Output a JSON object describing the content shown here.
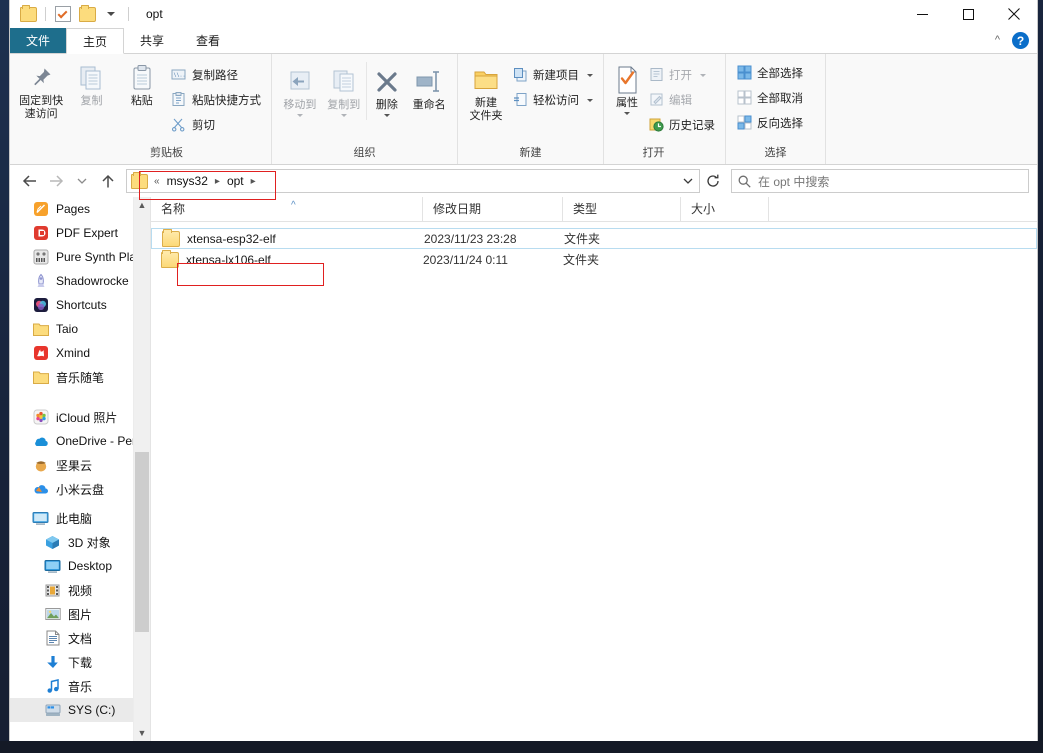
{
  "window": {
    "title": "opt",
    "controls": {
      "minimize": "minimize-icon",
      "maximize": "maximize-icon",
      "close": "close-icon"
    },
    "quick_access": [
      "folder-icon",
      "properties-checkbox-icon",
      "new-folder-icon",
      "customize-caret-icon"
    ]
  },
  "tabs": [
    {
      "label": "文件",
      "type": "file"
    },
    {
      "label": "主页",
      "type": "active"
    },
    {
      "label": "共享",
      "type": "normal"
    },
    {
      "label": "查看",
      "type": "normal"
    }
  ],
  "tabstrip_right": {
    "collapse_icon": "chevron-up-icon",
    "help_label": "?"
  },
  "ribbon": {
    "groups": [
      {
        "name": "clipboard",
        "label": "剪贴板",
        "big_buttons": [
          {
            "label": "固定到快\n速访问",
            "label_l1": "固定到快",
            "label_l2": "速访问",
            "icon": "pin-icon",
            "dim": false
          },
          {
            "label": "复制",
            "icon": "copy-icon",
            "dim": true
          },
          {
            "label": "粘贴",
            "icon": "paste-icon",
            "dim": false
          }
        ],
        "small_buttons": [
          {
            "label": "复制路径",
            "icon": "copy-path-icon",
            "dim": false
          },
          {
            "label": "粘贴快捷方式",
            "icon": "paste-shortcut-icon",
            "dim": false
          },
          {
            "label": "剪切",
            "icon": "scissors-icon",
            "dim": false
          }
        ]
      },
      {
        "name": "organize",
        "label": "组织",
        "big_buttons": [
          {
            "label": "移动到",
            "icon": "move-to-icon",
            "dim": true,
            "caret": true
          },
          {
            "label": "复制到",
            "icon": "copy-to-icon",
            "dim": true,
            "caret": true
          },
          {
            "label": "删除",
            "icon": "delete-x-icon",
            "dim": false,
            "caret": true
          },
          {
            "label": "重命名",
            "icon": "rename-icon",
            "dim": false
          }
        ]
      },
      {
        "name": "new",
        "label": "新建",
        "big_buttons": [
          {
            "label_l1": "新建",
            "label_l2": "文件夹",
            "icon": "new-folder-icon",
            "dim": false
          }
        ],
        "small_buttons": [
          {
            "label": "新建项目",
            "icon": "new-item-icon",
            "dim": false,
            "caret": true
          },
          {
            "label": "轻松访问",
            "icon": "easy-access-icon",
            "dim": false,
            "caret": true
          }
        ]
      },
      {
        "name": "open",
        "label": "打开",
        "big_buttons": [
          {
            "label": "属性",
            "icon": "properties-icon",
            "dim": false,
            "caret": true
          }
        ],
        "small_buttons": [
          {
            "label": "打开",
            "icon": "open-icon",
            "dim": true,
            "caret": true
          },
          {
            "label": "编辑",
            "icon": "edit-icon",
            "dim": true
          },
          {
            "label": "历史记录",
            "icon": "history-icon",
            "dim": false
          }
        ]
      },
      {
        "name": "select",
        "label": "选择",
        "small_buttons": [
          {
            "label": "全部选择",
            "icon": "select-all-icon",
            "dim": false
          },
          {
            "label": "全部取消",
            "icon": "select-none-icon",
            "dim": false
          },
          {
            "label": "反向选择",
            "icon": "invert-selection-icon",
            "dim": false
          }
        ]
      }
    ]
  },
  "addressbar": {
    "back_icon": "back-arrow-icon",
    "forward_icon": "forward-arrow-icon",
    "recent_icon": "recent-locations-caret-icon",
    "up_icon": "up-arrow-icon",
    "overflow": "«",
    "breadcrumbs": [
      "msys32",
      "opt"
    ],
    "dropdown_icon": "chevron-down-icon",
    "refresh_icon": "refresh-icon",
    "search_placeholder": "在 opt 中搜索",
    "search_icon": "search-icon"
  },
  "navpane": {
    "items": [
      {
        "label": "Pages",
        "icon": "pages-app-icon",
        "indent": false
      },
      {
        "label": "PDF Expert",
        "icon": "pdf-expert-icon",
        "indent": false
      },
      {
        "label": "Pure Synth Pla",
        "icon": "pure-synth-icon",
        "indent": false
      },
      {
        "label": "Shadowrocke",
        "icon": "shadowrocket-icon",
        "indent": false
      },
      {
        "label": "Shortcuts",
        "icon": "shortcuts-icon",
        "indent": false
      },
      {
        "label": "Taio",
        "icon": "folder-icon",
        "indent": false
      },
      {
        "label": "Xmind",
        "icon": "xmind-icon",
        "indent": false
      },
      {
        "label": "音乐随笔",
        "icon": "folder-icon",
        "indent": false
      },
      {
        "label": "iCloud 照片",
        "icon": "icloud-photos-icon",
        "indent": false
      },
      {
        "label": "OneDrive - Per",
        "icon": "onedrive-icon",
        "indent": false
      },
      {
        "label": "坚果云",
        "icon": "nutstore-icon",
        "indent": false
      },
      {
        "label": "小米云盘",
        "icon": "mi-cloud-icon",
        "indent": false
      },
      {
        "label": "此电脑",
        "icon": "this-pc-icon",
        "indent": false
      },
      {
        "label": "3D 对象",
        "icon": "3d-objects-icon",
        "indent": true
      },
      {
        "label": "Desktop",
        "icon": "desktop-icon",
        "indent": true
      },
      {
        "label": "视频",
        "icon": "videos-icon",
        "indent": true
      },
      {
        "label": "图片",
        "icon": "pictures-icon",
        "indent": true
      },
      {
        "label": "文档",
        "icon": "documents-icon",
        "indent": true
      },
      {
        "label": "下载",
        "icon": "downloads-icon",
        "indent": true
      },
      {
        "label": "音乐",
        "icon": "music-icon",
        "indent": true
      },
      {
        "label": "SYS (C:)",
        "icon": "drive-icon",
        "indent": true,
        "selected": true
      }
    ],
    "scrollbar": {
      "up_icon": "scroll-up-icon",
      "down_icon": "scroll-down-icon"
    }
  },
  "filelist": {
    "columns": [
      {
        "key": "name",
        "label": "名称"
      },
      {
        "key": "date",
        "label": "修改日期"
      },
      {
        "key": "type",
        "label": "类型"
      },
      {
        "key": "size",
        "label": "大小"
      }
    ],
    "sort_indicator": "^",
    "rows": [
      {
        "name": "xtensa-esp32-elf",
        "date": "2023/11/23 23:28",
        "type": "文件夹",
        "size": "",
        "icon": "folder-icon",
        "selected": true
      },
      {
        "name": "xtensa-lx106-elf",
        "date": "2023/11/24 0:11",
        "type": "文件夹",
        "size": "",
        "icon": "folder-icon",
        "selected": false
      }
    ]
  },
  "annotations": {
    "color": "#e02020",
    "boxes": [
      {
        "name": "address-path-highlight"
      },
      {
        "name": "folder-name-highlight"
      }
    ]
  }
}
